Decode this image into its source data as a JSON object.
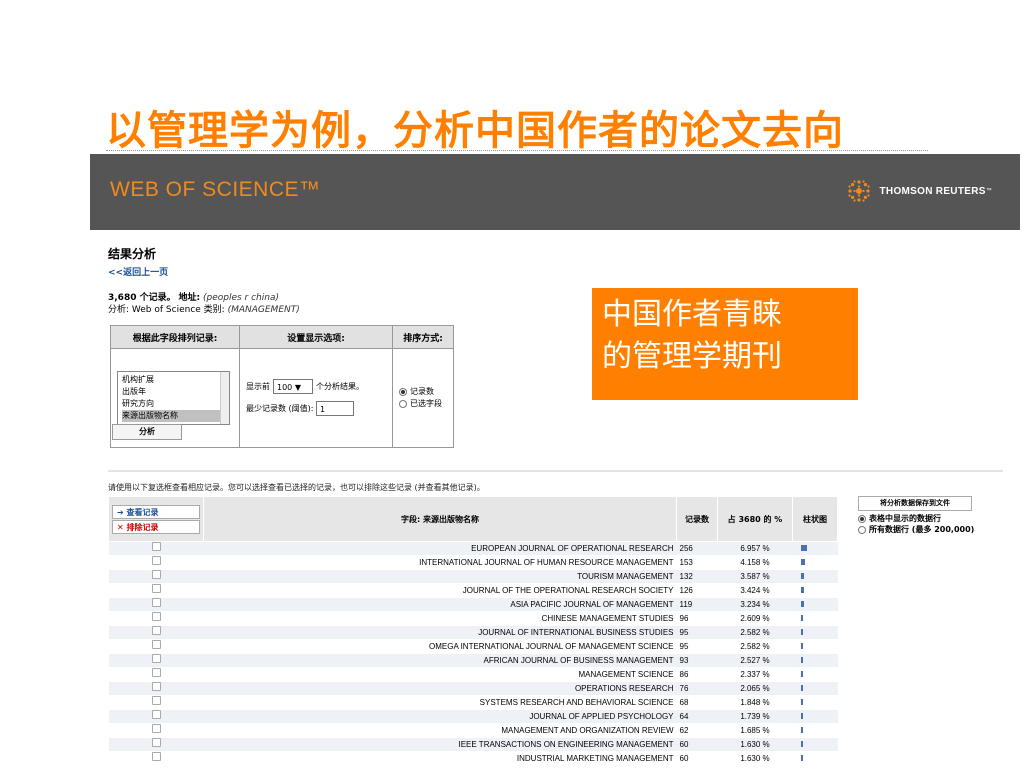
{
  "slide": {
    "title": "以管理学为例，分析中国作者的论文去向"
  },
  "header": {
    "logo": "WEB OF SCIENCE™",
    "brand": "THOMSON REUTERS",
    "brand_mark": "™"
  },
  "callout": {
    "line1": "中国作者青睐",
    "line2": "的管理学期刊"
  },
  "page": {
    "title": "结果分析",
    "back_link": "<<返回上一页",
    "records_count": "3,680 个记录。",
    "address_label": "地址:",
    "address_value": "(peoples r china)",
    "analysis_label": "分析: Web of Science 类别:",
    "analysis_value": "(MANAGEMENT)"
  },
  "options": {
    "col1_header": "根据此字段排列记录:",
    "col2_header": "设置显示选项:",
    "col3_header": "排序方式:",
    "list_items": [
      "机构扩展",
      "出版年",
      "研究方向",
      "来源出版物名称"
    ],
    "show_prefix": "显示前",
    "show_value": "100 ▼",
    "show_suffix": "个分析结果。",
    "min_label": "最少记录数 (阈值):",
    "min_value": "1",
    "sort_option1": "记录数",
    "sort_option2": "已选字段",
    "analyze_label": "分析"
  },
  "instructions": "请使用以下复选框查看相应记录。您可以选择查看已选择的记录，也可以排除这些记录 (并查看其他记录)。",
  "table": {
    "view_label": "➔ 查看记录",
    "exclude_label": "✕ 排除记录",
    "field_header": "字段: 来源出版物名称",
    "count_header": "记录数",
    "percent_header": "占 3680 的 %",
    "bar_header": "柱状图",
    "rows": [
      {
        "name": "EUROPEAN JOURNAL OF OPERATIONAL RESEARCH",
        "count": "256",
        "percent": "6.957 %",
        "value": 6.957
      },
      {
        "name": "INTERNATIONAL JOURNAL OF HUMAN RESOURCE MANAGEMENT",
        "count": "153",
        "percent": "4.158 %",
        "value": 4.158
      },
      {
        "name": "TOURISM MANAGEMENT",
        "count": "132",
        "percent": "3.587 %",
        "value": 3.587
      },
      {
        "name": "JOURNAL OF THE OPERATIONAL RESEARCH SOCIETY",
        "count": "126",
        "percent": "3.424 %",
        "value": 3.424
      },
      {
        "name": "ASIA PACIFIC JOURNAL OF MANAGEMENT",
        "count": "119",
        "percent": "3.234 %",
        "value": 3.234
      },
      {
        "name": "CHINESE MANAGEMENT STUDIES",
        "count": "96",
        "percent": "2.609 %",
        "value": 2.609
      },
      {
        "name": "JOURNAL OF INTERNATIONAL BUSINESS STUDIES",
        "count": "95",
        "percent": "2.582 %",
        "value": 2.582
      },
      {
        "name": "OMEGA INTERNATIONAL JOURNAL OF MANAGEMENT SCIENCE",
        "count": "95",
        "percent": "2.582 %",
        "value": 2.582
      },
      {
        "name": "AFRICAN JOURNAL OF BUSINESS MANAGEMENT",
        "count": "93",
        "percent": "2.527 %",
        "value": 2.527
      },
      {
        "name": "MANAGEMENT SCIENCE",
        "count": "86",
        "percent": "2.337 %",
        "value": 2.337
      },
      {
        "name": "OPERATIONS RESEARCH",
        "count": "76",
        "percent": "2.065 %",
        "value": 2.065
      },
      {
        "name": "SYSTEMS RESEARCH AND BEHAVIORAL SCIENCE",
        "count": "68",
        "percent": "1.848 %",
        "value": 1.848
      },
      {
        "name": "JOURNAL OF APPLIED PSYCHOLOGY",
        "count": "64",
        "percent": "1.739 %",
        "value": 1.739
      },
      {
        "name": "MANAGEMENT AND ORGANIZATION REVIEW",
        "count": "62",
        "percent": "1.685 %",
        "value": 1.685
      },
      {
        "name": "IEEE TRANSACTIONS ON ENGINEERING MANAGEMENT",
        "count": "60",
        "percent": "1.630 %",
        "value": 1.63
      },
      {
        "name": "INDUSTRIAL MARKETING MANAGEMENT",
        "count": "60",
        "percent": "1.630 %",
        "value": 1.63
      }
    ]
  },
  "save": {
    "button_label": "将分析数据保存到文件",
    "option1": "表格中显示的数据行",
    "option2": "所有数据行 (最多 200,000)"
  },
  "colors": {
    "accent": "#ff8000",
    "header_bg": "#555555",
    "bar": "#4a6fb5",
    "link": "#1a4f94"
  }
}
